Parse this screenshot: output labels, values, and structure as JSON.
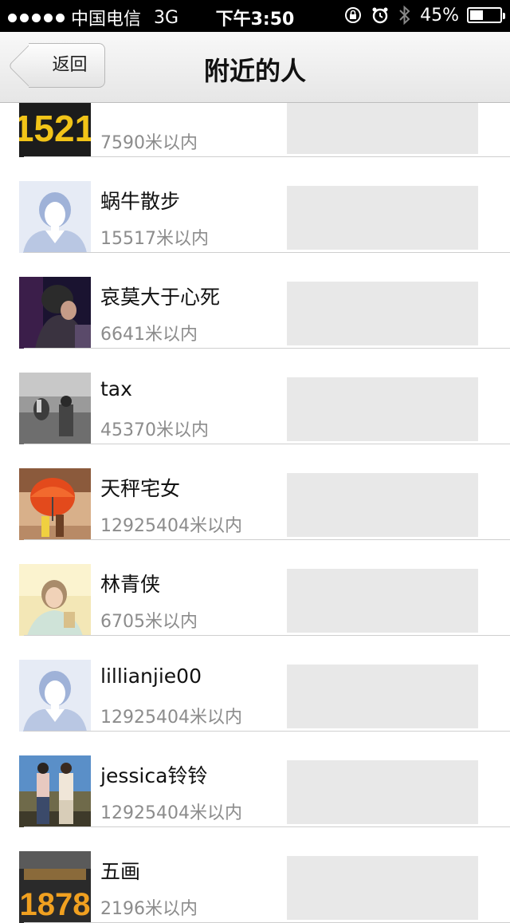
{
  "status_bar": {
    "carrier": "中国电信",
    "network": "3G",
    "time": "下午3:50",
    "battery": "45%",
    "battery_level": 0.45
  },
  "nav": {
    "back_label": "返回",
    "title": "附近的人"
  },
  "people": [
    {
      "name": "",
      "distance": "7590米以内",
      "avatar": "photo-1521-sign"
    },
    {
      "name": "蜗牛散步",
      "distance": "15517米以内",
      "avatar": "default-avatar"
    },
    {
      "name": "哀莫大于心死",
      "distance": "6641米以内",
      "avatar": "photo-couple-dark"
    },
    {
      "name": "tax",
      "distance": "45370米以内",
      "avatar": "photo-gray-gesture"
    },
    {
      "name": "天秤宅女",
      "distance": "12925404米以内",
      "avatar": "photo-red-umbrella"
    },
    {
      "name": "林青侠",
      "distance": "6705米以内",
      "avatar": "photo-light-portrait"
    },
    {
      "name": "lillianjie00",
      "distance": "12925404米以内",
      "avatar": "default-avatar"
    },
    {
      "name": "jessica铃铃",
      "distance": "12925404米以内",
      "avatar": "photo-couple-field"
    },
    {
      "name": "五画",
      "distance": "2196米以内",
      "avatar": "photo-1878-sign"
    }
  ],
  "avatar_texts": {
    "sign_1521": "1521",
    "sign_1878": "1878"
  }
}
